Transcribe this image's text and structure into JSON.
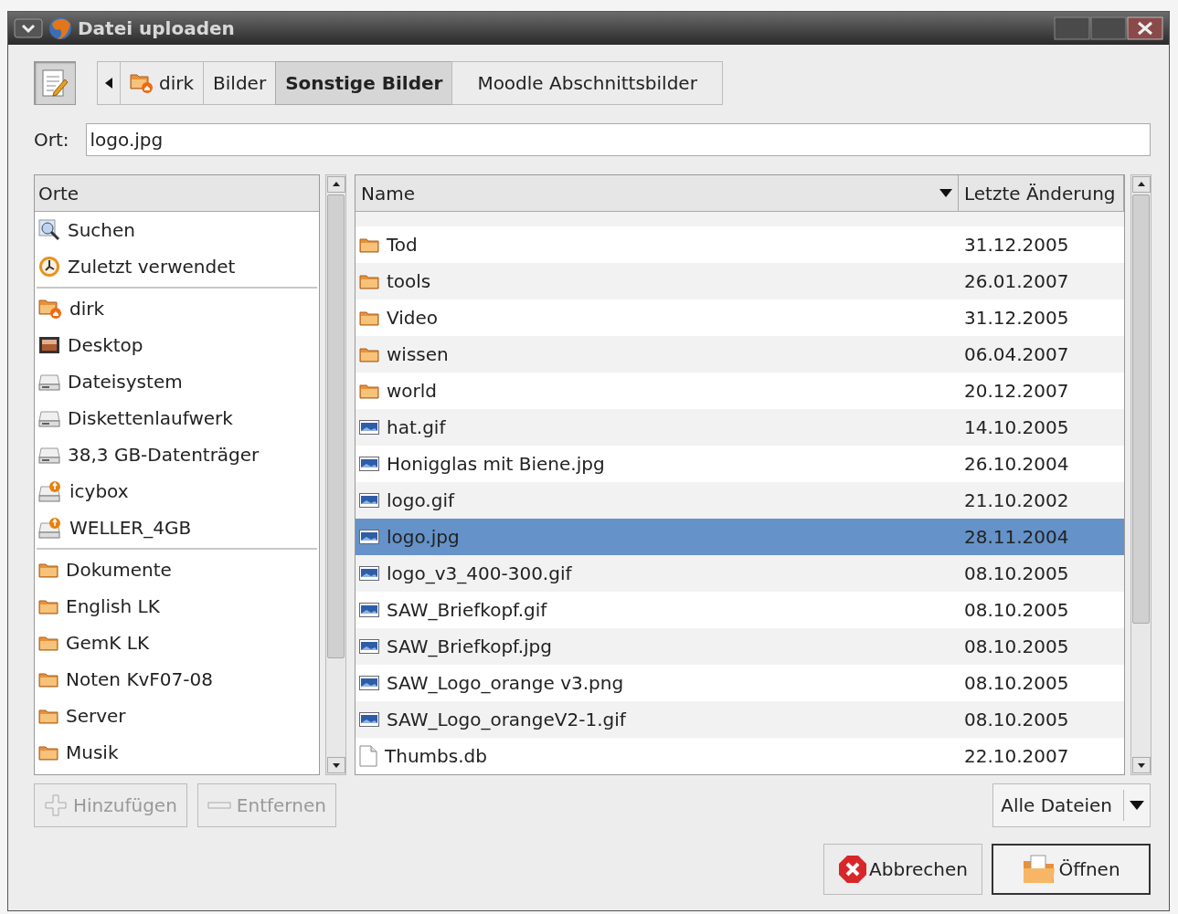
{
  "window": {
    "title": "Datei uploaden"
  },
  "pathbar": {
    "edit_toggle": {
      "pressed": true
    },
    "segments": [
      {
        "label": "dirk",
        "kind": "home",
        "selected": false
      },
      {
        "label": "Bilder",
        "selected": false
      },
      {
        "label": "Sonstige Bilder",
        "selected": true
      },
      {
        "label": "Moodle Abschnittsbilder",
        "selected": false
      }
    ]
  },
  "location": {
    "label": "Ort:",
    "value": "logo.jpg"
  },
  "places": {
    "header": "Orte",
    "groups": [
      [
        {
          "label": "Suchen",
          "kind": "search"
        },
        {
          "label": "Zuletzt verwendet",
          "kind": "recent"
        }
      ],
      [
        {
          "label": "dirk",
          "kind": "home"
        },
        {
          "label": "Desktop",
          "kind": "desktop"
        },
        {
          "label": "Dateisystem",
          "kind": "drive"
        },
        {
          "label": "Diskettenlaufwerk",
          "kind": "drive"
        },
        {
          "label": "38,3 GB-Datenträger",
          "kind": "drive"
        },
        {
          "label": "icybox",
          "kind": "usb"
        },
        {
          "label": "WELLER_4GB",
          "kind": "usb"
        }
      ],
      [
        {
          "label": "Dokumente",
          "kind": "folder"
        },
        {
          "label": "English LK",
          "kind": "folder"
        },
        {
          "label": "GemK LK",
          "kind": "folder"
        },
        {
          "label": "Noten KvF07-08",
          "kind": "folder"
        },
        {
          "label": "Server",
          "kind": "folder"
        },
        {
          "label": "Musik",
          "kind": "folder"
        }
      ]
    ]
  },
  "files": {
    "columns": [
      {
        "label": "Name",
        "sorted": true
      },
      {
        "label": "Letzte Änderung",
        "sorted": false
      }
    ],
    "rows": [
      {
        "name": "Tod",
        "date": "31.12.2005",
        "kind": "folder",
        "selected": false
      },
      {
        "name": "tools",
        "date": "26.01.2007",
        "kind": "folder",
        "selected": false
      },
      {
        "name": "Video",
        "date": "31.12.2005",
        "kind": "folder",
        "selected": false
      },
      {
        "name": "wissen",
        "date": "06.04.2007",
        "kind": "folder",
        "selected": false
      },
      {
        "name": "world",
        "date": "20.12.2007",
        "kind": "folder",
        "selected": false
      },
      {
        "name": "hat.gif",
        "date": "14.10.2005",
        "kind": "image",
        "selected": false
      },
      {
        "name": "Honigglas mit Biene.jpg",
        "date": "26.10.2004",
        "kind": "image",
        "selected": false
      },
      {
        "name": "logo.gif",
        "date": "21.10.2002",
        "kind": "image",
        "selected": false
      },
      {
        "name": "logo.jpg",
        "date": "28.11.2004",
        "kind": "image",
        "selected": true
      },
      {
        "name": "logo_v3_400-300.gif",
        "date": "08.10.2005",
        "kind": "image",
        "selected": false
      },
      {
        "name": "SAW_Briefkopf.gif",
        "date": "08.10.2005",
        "kind": "image",
        "selected": false
      },
      {
        "name": "SAW_Briefkopf.jpg",
        "date": "08.10.2005",
        "kind": "image",
        "selected": false
      },
      {
        "name": "SAW_Logo_orange v3.png",
        "date": "08.10.2005",
        "kind": "image",
        "selected": false
      },
      {
        "name": "SAW_Logo_orangeV2-1.gif",
        "date": "08.10.2005",
        "kind": "image",
        "selected": false
      },
      {
        "name": "Thumbs.db",
        "date": "22.10.2007",
        "kind": "file",
        "selected": false
      }
    ]
  },
  "place_buttons": [
    {
      "label": "Hinzufügen",
      "kind": "add",
      "disabled": true
    },
    {
      "label": "Entfernen",
      "kind": "remove",
      "disabled": true
    }
  ],
  "filter": {
    "value": "Alle Dateien"
  },
  "actions": [
    {
      "label": "Abbrechen",
      "kind": "cancel",
      "default": false
    },
    {
      "label": "Öffnen",
      "kind": "open",
      "default": true
    }
  ]
}
